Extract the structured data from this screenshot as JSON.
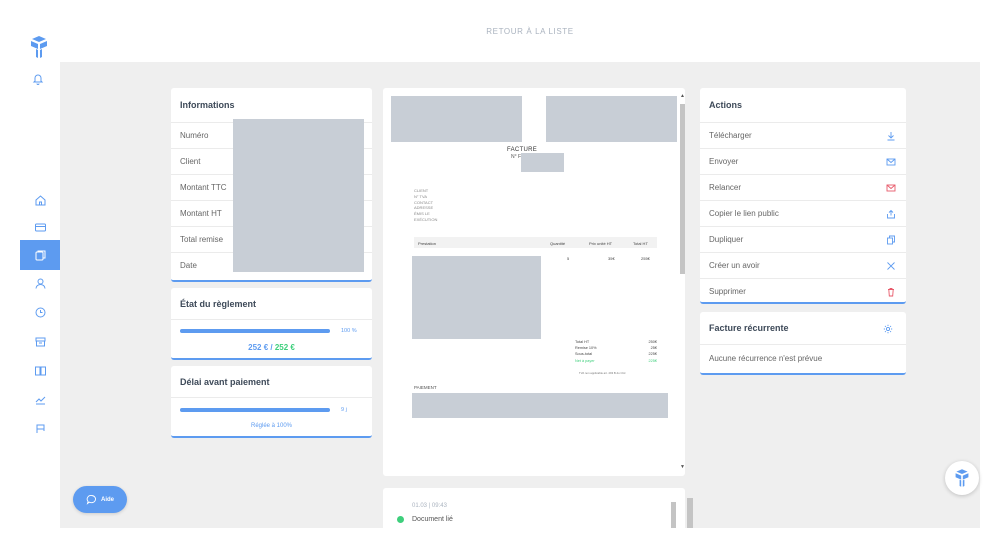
{
  "topbar": {
    "back_label": "RETOUR À LA LISTE"
  },
  "sidebar": {
    "items": [
      {
        "icon": "home-icon",
        "active": false
      },
      {
        "icon": "card-icon",
        "active": false
      },
      {
        "icon": "documents-icon",
        "active": true
      },
      {
        "icon": "user-icon",
        "active": false
      },
      {
        "icon": "clock-icon",
        "active": false
      },
      {
        "icon": "box-icon",
        "active": false
      },
      {
        "icon": "book-icon",
        "active": false
      },
      {
        "icon": "chart-icon",
        "active": false
      },
      {
        "icon": "flag-icon",
        "active": false
      }
    ]
  },
  "informations": {
    "title": "Informations",
    "rows": [
      "Numéro",
      "Client",
      "Montant TTC",
      "Montant HT",
      "Total remise",
      "Date"
    ]
  },
  "etat_reglement": {
    "title": "État du règlement",
    "progress": 100,
    "percent_label": "100 %",
    "amount_paid": "252 €",
    "separator": " / ",
    "amount_total": "252 €"
  },
  "delai_paiement": {
    "title": "Délai avant paiement",
    "progress": 100,
    "days_label": "9 j",
    "subtitle": "Réglée à 100%"
  },
  "invoice_preview": {
    "title": "FACTURE",
    "number_prefix": "N° F",
    "client_fields": [
      "CLIENT",
      "N° TVA",
      "CONTACT",
      "ADRESSE",
      "ÉMIS LE",
      "EXÉCUTION"
    ],
    "table_headers": [
      "Prestation",
      "Quantité",
      "Prix unité HT",
      "Total HT"
    ],
    "row": {
      "quantity": "5",
      "unit_price": "35€",
      "total": "255€"
    },
    "totals": [
      {
        "label": "Total HT",
        "value": "250€"
      },
      {
        "label": "Remise 10%",
        "value": "25€"
      },
      {
        "label": "Sous-total",
        "value": "225€"
      },
      {
        "label": "Net à payer",
        "value": "225€"
      }
    ],
    "tva_note": "TVA non applicable art. 293 B du CGI",
    "paiement_label": "PAIEMENT"
  },
  "actions": {
    "title": "Actions",
    "items": [
      {
        "label": "Télécharger",
        "icon": "download-icon",
        "color": "#5d9bf0"
      },
      {
        "label": "Envoyer",
        "icon": "mail-icon",
        "color": "#5d9bf0"
      },
      {
        "label": "Relancer",
        "icon": "mail-alert-icon",
        "color": "#e85a6a"
      },
      {
        "label": "Copier le lien public",
        "icon": "share-icon",
        "color": "#5d9bf0"
      },
      {
        "label": "Dupliquer",
        "icon": "duplicate-icon",
        "color": "#5d9bf0"
      },
      {
        "label": "Créer un avoir",
        "icon": "cross-icon",
        "color": "#5d9bf0"
      },
      {
        "label": "Supprimer",
        "icon": "trash-icon",
        "color": "#e85a6a"
      }
    ]
  },
  "recurrence": {
    "title": "Facture récurrente",
    "text": "Aucune récurrence n'est prévue"
  },
  "timeline": {
    "time": "01.03 | 09:43",
    "event": "Document lié"
  },
  "aide": {
    "label": "Aide"
  },
  "colors": {
    "accent": "#5d9bf0",
    "success": "#3ecf7c",
    "danger": "#e85a6a",
    "background": "#efefef"
  }
}
